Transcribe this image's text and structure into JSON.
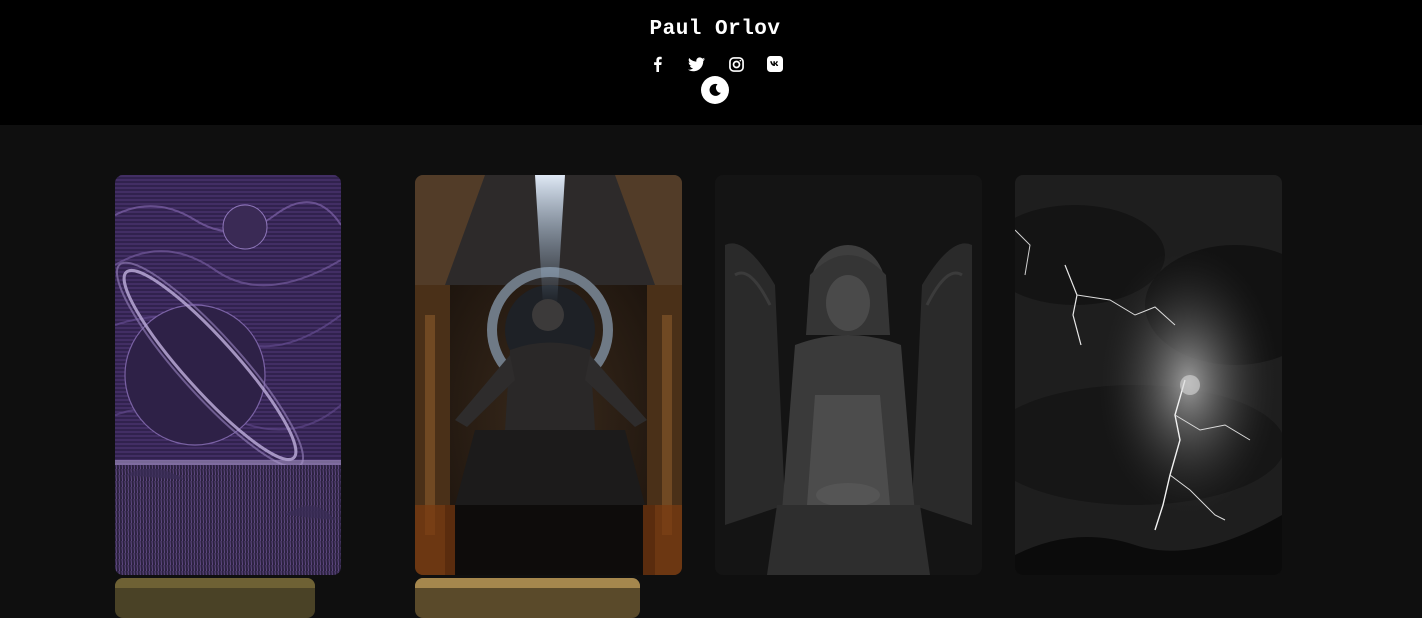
{
  "header": {
    "title": "Paul Orlov",
    "social": [
      {
        "name": "facebook-icon"
      },
      {
        "name": "twitter-icon"
      },
      {
        "name": "instagram-icon"
      },
      {
        "name": "vk-icon"
      }
    ],
    "theme_toggle_icon": "moon-icon"
  },
  "colors": {
    "header_bg": "#000000",
    "page_bg": "#0f0f0f",
    "text": "#ffffff"
  },
  "gallery": {
    "items": [
      {
        "name": "saturn-engraving-artwork",
        "palette": "purple"
      },
      {
        "name": "zeus-throne-artwork",
        "palette": "bronze"
      },
      {
        "name": "angel-statue-artwork",
        "palette": "gray"
      },
      {
        "name": "lightning-storm-artwork",
        "palette": "monochrome"
      },
      {
        "name": "golden-artwork-partial",
        "palette": "gold"
      },
      {
        "name": "golden-interior-artwork-partial",
        "palette": "gold"
      }
    ]
  }
}
